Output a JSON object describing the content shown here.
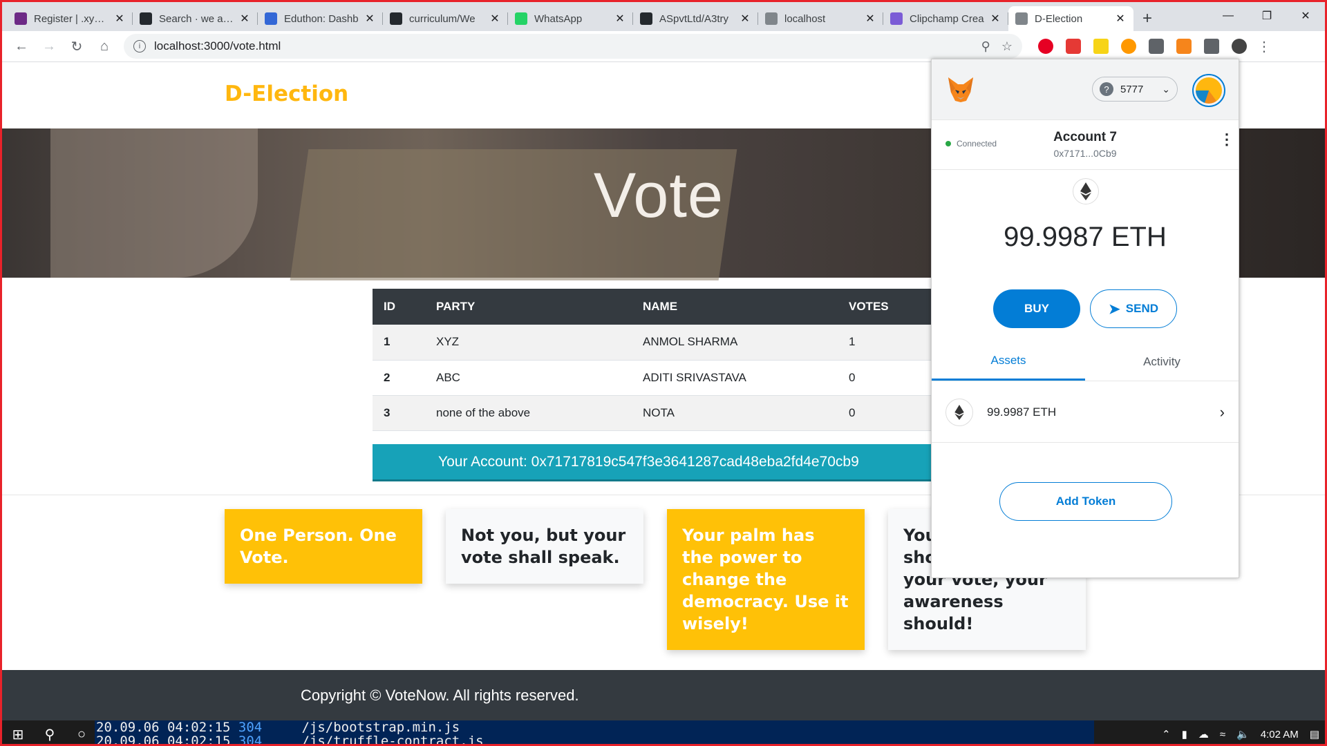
{
  "browser": {
    "tabs": [
      {
        "label": "Register | .xyz D",
        "favicon": "xyz",
        "color": "#6d2a86"
      },
      {
        "label": "Search · we app",
        "favicon": "github",
        "color": "#24292e"
      },
      {
        "label": "Eduthon: Dashb",
        "favicon": "doc",
        "color": "#3367d6"
      },
      {
        "label": "curriculum/We",
        "favicon": "github",
        "color": "#24292e"
      },
      {
        "label": "WhatsApp",
        "favicon": "whatsapp",
        "color": "#25d366"
      },
      {
        "label": "ASpvtLtd/A3try",
        "favicon": "github",
        "color": "#24292e"
      },
      {
        "label": "localhost",
        "favicon": "globe",
        "color": "#80868b"
      },
      {
        "label": "Clipchamp Crea",
        "favicon": "C",
        "color": "#7b5cd6"
      },
      {
        "label": "D-Election",
        "favicon": "globe",
        "color": "#80868b",
        "active": true
      }
    ],
    "url": "localhost:3000/vote.html"
  },
  "page": {
    "brand": "D-Election",
    "hero_title": "Vote",
    "table": {
      "headers": [
        "ID",
        "PARTY",
        "NAME",
        "VOTES"
      ],
      "rows": [
        {
          "id": "1",
          "party": "XYZ",
          "name": "ANMOL SHARMA",
          "votes": "1"
        },
        {
          "id": "2",
          "party": "ABC",
          "name": "ADITI SRIVASTAVA",
          "votes": "0"
        },
        {
          "id": "3",
          "party": "none of the above",
          "name": "NOTA",
          "votes": "0"
        }
      ]
    },
    "account_banner": "Your Account: 0x71717819c547f3e3641287cad48eba2fd4e70cb9",
    "quotes": [
      {
        "text": "One Person. One Vote.",
        "style": "yellow"
      },
      {
        "text": "Not you, but your vote shall speak.",
        "style": "light"
      },
      {
        "text": "Your palm has the power to change the democracy. Use it wisely!",
        "style": "yellow"
      },
      {
        "text": "Your culture should not decide your vote, your awareness should!",
        "style": "light"
      }
    ],
    "footer": "Copyright © VoteNow. All rights reserved."
  },
  "metamask": {
    "network": "5777",
    "status": "Connected",
    "account_name": "Account 7",
    "account_address": "0x7171...0Cb9",
    "balance": "99.9987 ETH",
    "buy_label": "BUY",
    "send_label": "SEND",
    "tab_assets": "Assets",
    "tab_activity": "Activity",
    "asset_balance": "99.9987 ETH",
    "add_token_label": "Add Token"
  },
  "taskbar": {
    "console_lines": [
      {
        "date": "20.09.06 04:02:15",
        "code": "304",
        "path": "/js/bootstrap.min.js"
      },
      {
        "date": "20.09.06 04:02:15",
        "code": "304",
        "path": "/js/truffle-contract.js"
      }
    ],
    "time": "4:02 AM"
  },
  "colors": {
    "brand": "#ffb70f",
    "table_header": "#343a40",
    "account_banner": "#17a2b8",
    "quote_yellow": "#ffc107",
    "metamask_blue": "#037dd6",
    "footer": "#343a40"
  }
}
